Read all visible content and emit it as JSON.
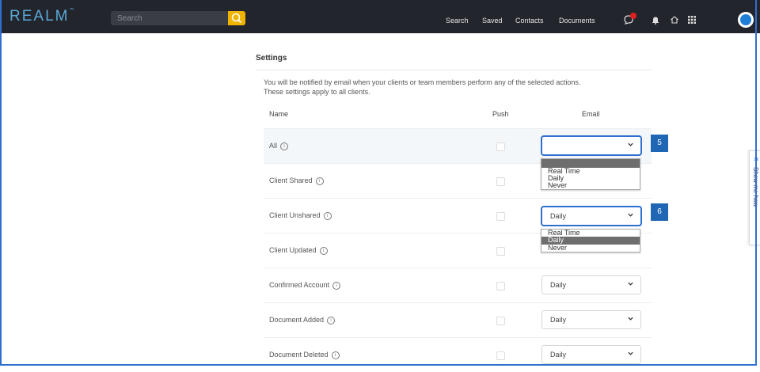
{
  "header": {
    "logo": "REALM",
    "logo_mark": "™",
    "search_placeholder": "Search",
    "nav": [
      "Search",
      "Saved",
      "Contacts",
      "Documents"
    ],
    "icons": [
      "chat-notification-icon",
      "bell-icon",
      "home-icon",
      "apps-grid-icon"
    ],
    "notification_color": "#e02020"
  },
  "settings": {
    "title": "Settings",
    "description_line1": "You will be notified by email when your clients or team members perform any of the selected actions.",
    "description_line2": "These settings apply to all clients.",
    "columns": {
      "name": "Name",
      "push": "Push",
      "email": "Email"
    },
    "rows": [
      {
        "label": "All",
        "email_value": ""
      },
      {
        "label": "Client Shared",
        "email_value": ""
      },
      {
        "label": "Client Unshared",
        "email_value": "Daily"
      },
      {
        "label": "Client Updated",
        "email_value": ""
      },
      {
        "label": "Confirmed Account",
        "email_value": "Daily"
      },
      {
        "label": "Document Added",
        "email_value": "Daily"
      },
      {
        "label": "Document Deleted",
        "email_value": "Daily"
      }
    ],
    "info_glyph": "i"
  },
  "dropdown1": {
    "options": [
      "",
      "Real Time",
      "Daily",
      "Never"
    ],
    "selected": ""
  },
  "dropdown2": {
    "options": [
      "Real Time",
      "Daily",
      "Never"
    ],
    "selected": "Daily"
  },
  "badges": [
    "5",
    "6"
  ],
  "side_tab": {
    "label": "Show me how",
    "icon": "sparkle-icon"
  },
  "colors": {
    "accent": "#2f6fd1",
    "topbar": "#23252c",
    "search_button": "#f0b400",
    "badge": "#1f67b5"
  }
}
